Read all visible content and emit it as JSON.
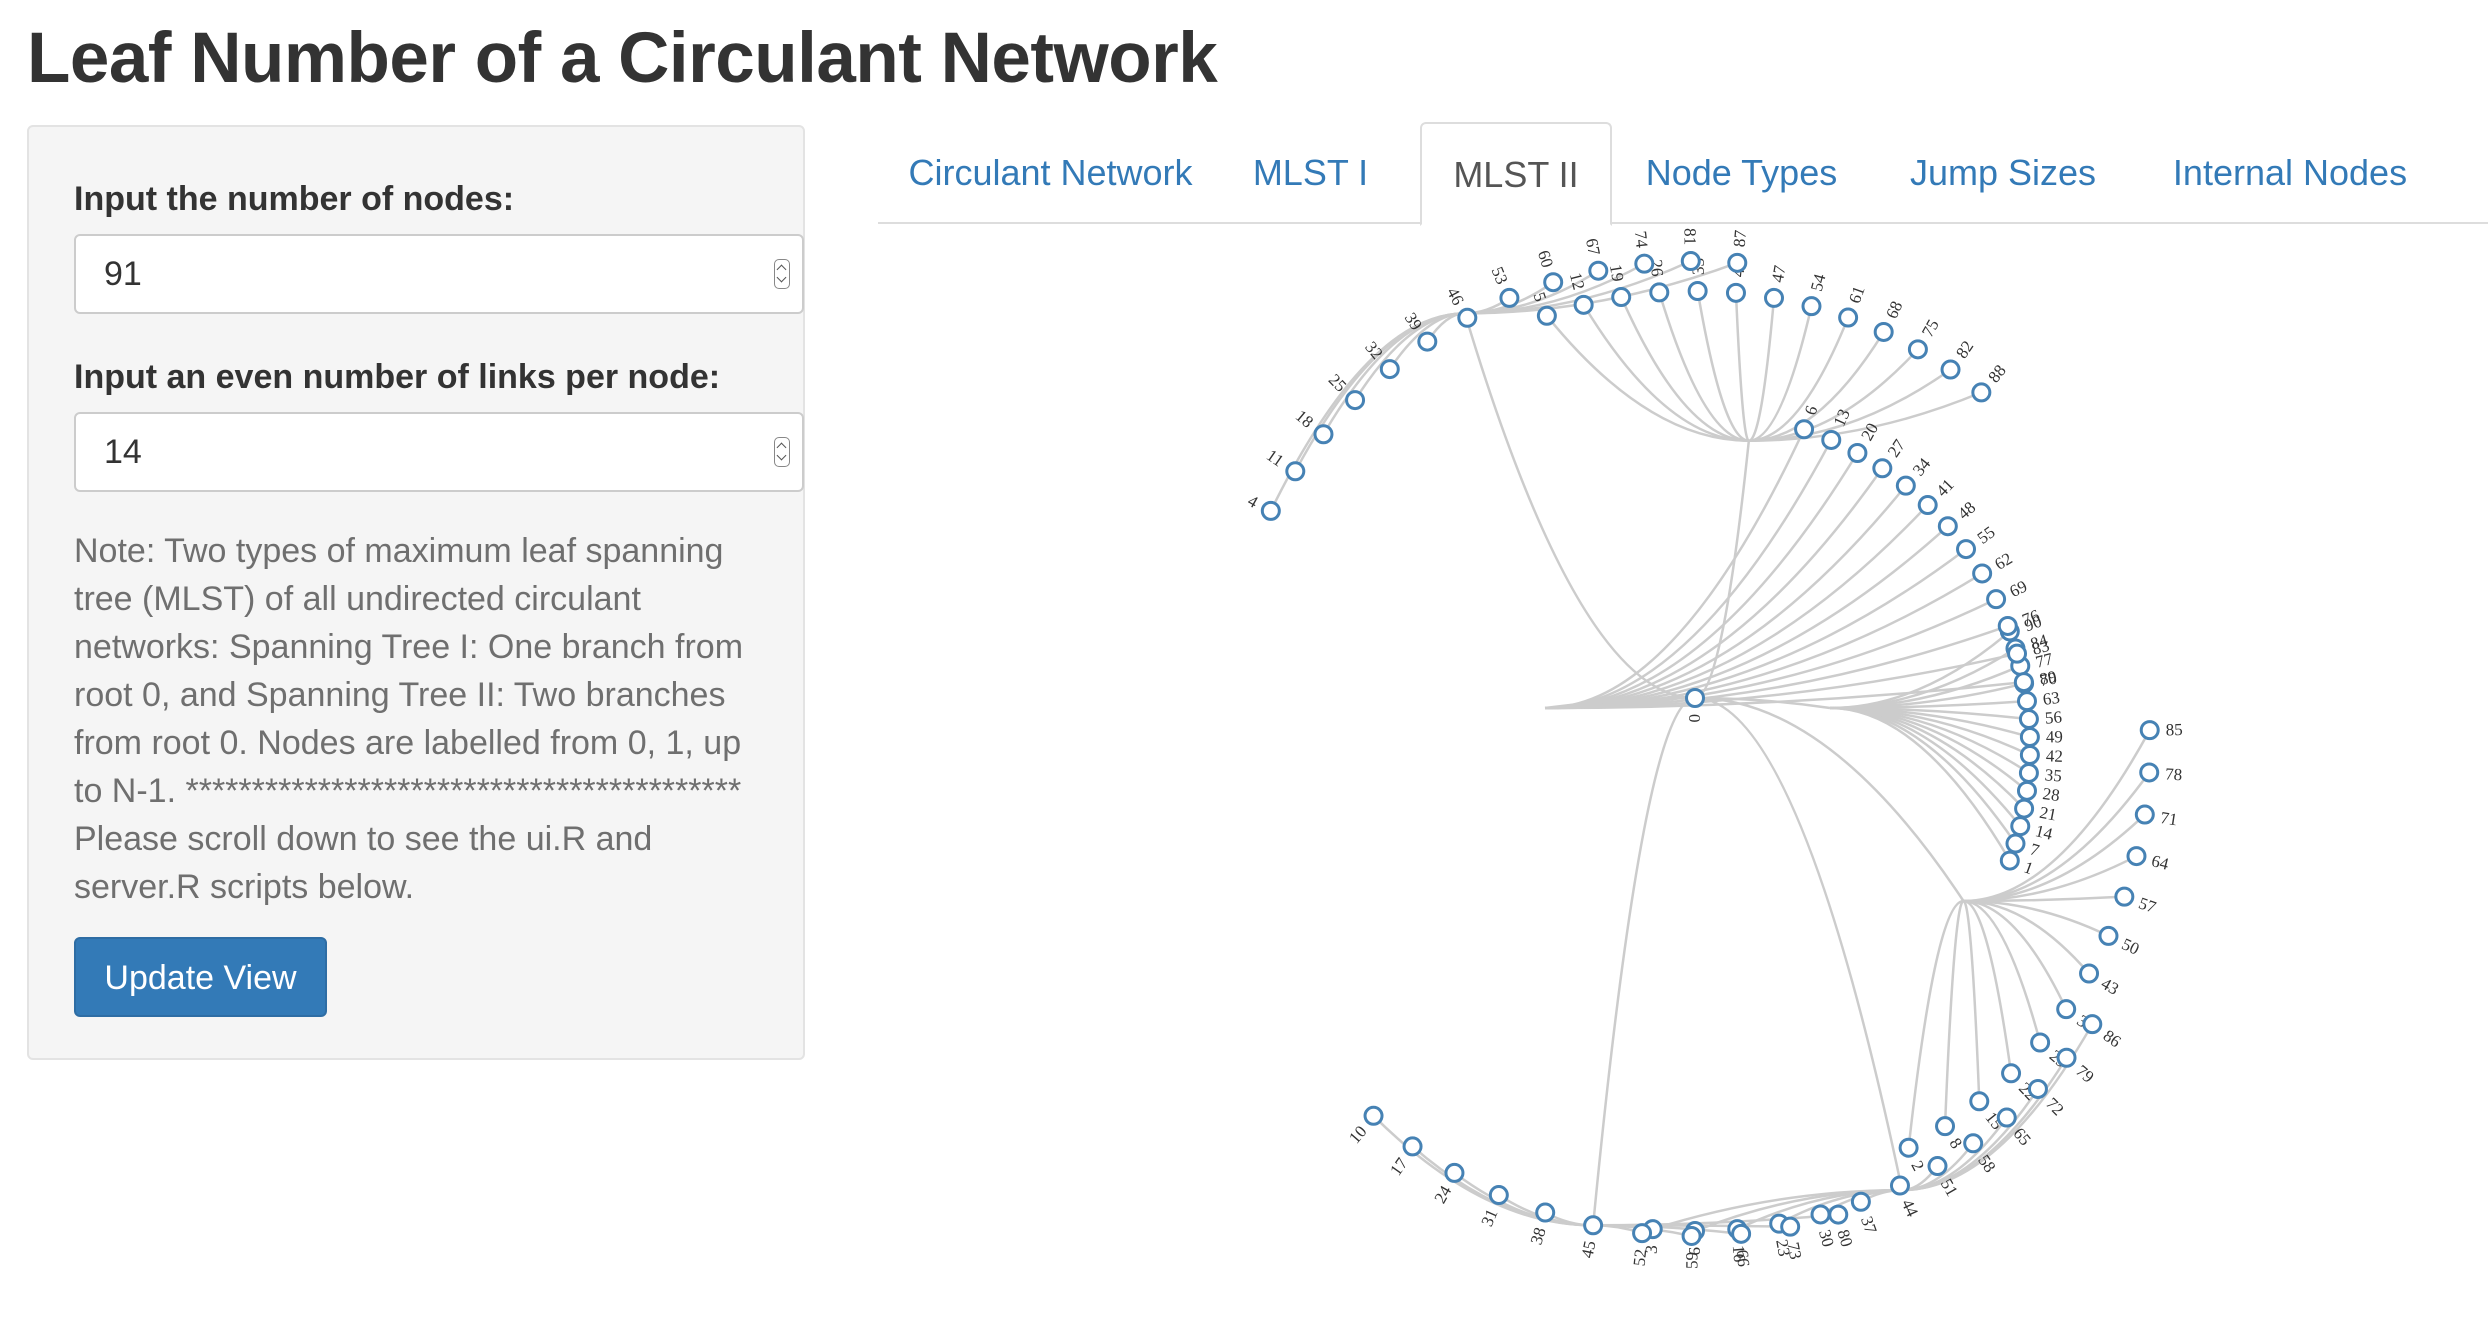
{
  "page": {
    "title": "Leaf Number of a Circulant Network"
  },
  "sidebar": {
    "nodes_label": "Input the number of nodes:",
    "nodes_value": "91",
    "links_label": "Input an even number of links per node:",
    "links_value": "14",
    "note": "Note: Two types of maximum leaf spanning tree (MLST) of all undirected circulant networks: Spanning Tree I: One branch from root 0, and Spanning Tree II: Two branches from root 0. Nodes are labelled from 0, 1, up to N-1. ****************************************** Please scroll down to see the ui.R and server.R scripts below.",
    "update_button": "Update View"
  },
  "tabs": [
    {
      "label": "Circulant Network",
      "active": false
    },
    {
      "label": "MLST I",
      "active": false
    },
    {
      "label": "MLST II",
      "active": true
    },
    {
      "label": "Node Types",
      "active": false
    },
    {
      "label": "Jump Sizes",
      "active": false
    },
    {
      "label": "Internal Nodes",
      "active": false
    }
  ],
  "tree": {
    "root": "0",
    "node_stroke": "#4682b4",
    "link_color": "#cccccc",
    "branches": [
      {
        "hub": "1",
        "root_child": "1",
        "children": [
          "1",
          "7",
          "14",
          "21",
          "28",
          "35",
          "42",
          "49",
          "56",
          "63",
          "70",
          "77",
          "84",
          "90"
        ]
      },
      {
        "hub": "1",
        "root_child": "",
        "children": [
          "2",
          "8",
          "15",
          "22",
          "29",
          "36",
          "43",
          "50",
          "57",
          "64",
          "71",
          "78",
          "85"
        ]
      },
      {
        "hub": "2",
        "root_child": "",
        "children": [
          "3",
          "9",
          "16",
          "23",
          "30",
          "37",
          "44",
          "51",
          "58",
          "65",
          "72",
          "79",
          "86"
        ]
      },
      {
        "hub": "3",
        "root_child": "",
        "children": [
          "10",
          "17",
          "24",
          "31",
          "38",
          "45",
          "52",
          "59",
          "66",
          "73",
          "80"
        ]
      },
      {
        "hub": "90",
        "root_child": "",
        "children": [
          "89",
          "83",
          "76",
          "69",
          "62",
          "55",
          "48",
          "41",
          "34",
          "27",
          "20",
          "13",
          "6"
        ]
      },
      {
        "hub": "89",
        "root_child": "",
        "children": [
          "88",
          "82",
          "75",
          "68",
          "61",
          "54",
          "47",
          "40",
          "33",
          "26",
          "19",
          "12",
          "5"
        ]
      },
      {
        "hub": "88",
        "root_child": "",
        "children": [
          "87",
          "81",
          "74",
          "67",
          "60",
          "53",
          "46",
          "39",
          "32",
          "25",
          "18",
          "11",
          "4"
        ]
      }
    ]
  }
}
